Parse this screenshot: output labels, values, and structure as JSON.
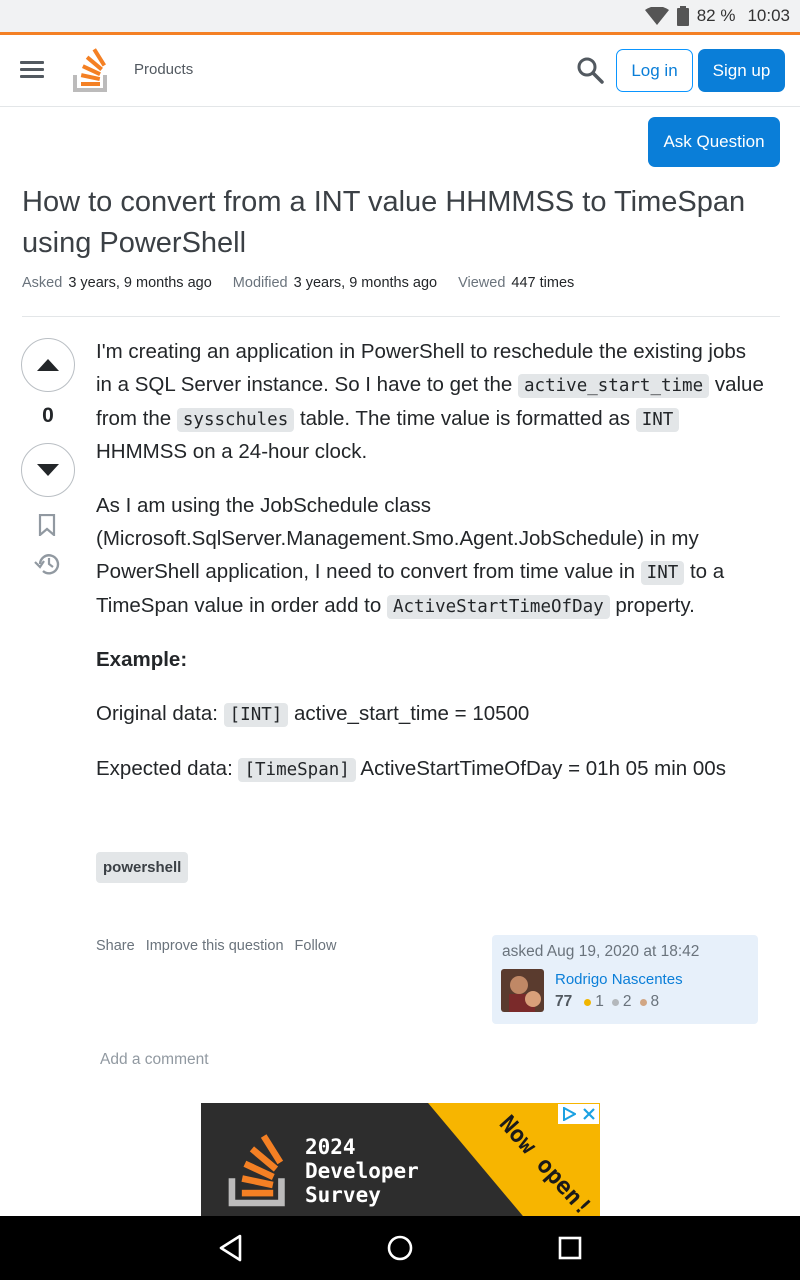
{
  "status_bar": {
    "battery": "82 %",
    "time": "10:03"
  },
  "nav": {
    "products": "Products",
    "login": "Log in",
    "signup": "Sign up"
  },
  "ask_button": "Ask Question",
  "question": {
    "title": "How to convert from a INT value HHMMSS to TimeSpan using PowerShell",
    "meta": {
      "asked_label": "Asked",
      "asked_value": "3 years, 9 months ago",
      "modified_label": "Modified",
      "modified_value": "3 years, 9 months ago",
      "viewed_label": "Viewed",
      "viewed_value": "447 times"
    },
    "votes": "0",
    "body": {
      "p1_a": "I'm creating an application in PowerShell to reschedule the existing jobs in a SQL Server instance. So I have to get the ",
      "p1_code1": "active_start_time",
      "p1_b": " value from the ",
      "p1_code2": "sysschules",
      "p1_c": " table. The time value is formatted as ",
      "p1_code3": "INT",
      "p1_d": " HHMMSS on a 24-hour clock.",
      "p2_a": "As I am using the JobSchedule class (Microsoft.SqlServer.Management.Smo.Agent.JobSchedule) in my PowerShell application, I need to convert from time value in ",
      "p2_code1": "INT",
      "p2_b": " to a TimeSpan value in order add to ",
      "p2_code2": "ActiveStartTimeOfDay",
      "p2_c": " property.",
      "example_heading": "Example:",
      "p3_a": "Original data: ",
      "p3_code": "[INT]",
      "p3_b": " active_start_time = 10500",
      "p4_a": "Expected data: ",
      "p4_code": "[TimeSpan]",
      "p4_b": " ActiveStartTimeOfDay = 01h 05 min 00s"
    },
    "tags": [
      "powershell"
    ],
    "actions": {
      "share": "Share",
      "improve": "Improve this question",
      "follow": "Follow"
    },
    "owner": {
      "asked_text": "asked Aug 19, 2020 at 18:42",
      "name": "Rodrigo Nascentes",
      "reputation": "77",
      "gold": "1",
      "silver": "2",
      "bronze": "8"
    },
    "add_comment": "Add a comment"
  },
  "ad": {
    "line1": "2024",
    "line2": "Developer",
    "line3": "Survey",
    "banner": "Now open!"
  },
  "colors": {
    "accent": "#0a7ed8",
    "brand_orange": "#f48024",
    "gold": "#f1b600",
    "silver": "#b4b8bc",
    "bronze": "#d1a684"
  }
}
